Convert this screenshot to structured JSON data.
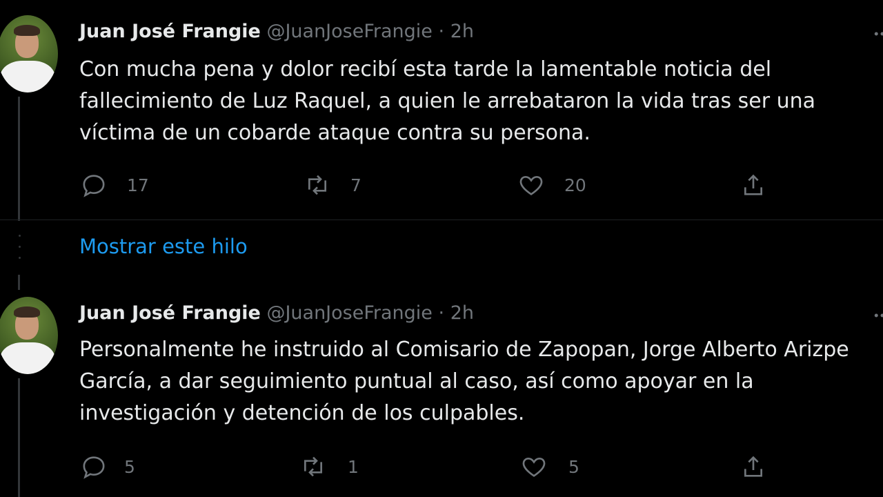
{
  "tweets": [
    {
      "name": "Juan José Frangie",
      "handle": "@JuanJoseFrangie",
      "separator": "·",
      "time": "2h",
      "text": "Con mucha pena y dolor recibí esta tarde la lamentable noticia del fallecimiento de Luz Raquel, a quien le arrebataron la vida tras ser una víctima de un cobarde ataque contra su persona.",
      "replies": "17",
      "retweets": "7",
      "likes": "20"
    },
    {
      "name": "Juan José Frangie",
      "handle": "@JuanJoseFrangie",
      "separator": "·",
      "time": "2h",
      "text": "Personalmente he instruido al Comisario de Zapopan, Jorge Alberto Arizpe García, a dar seguimiento puntual al caso, así como apoyar en la investigación y detención de los culpables.",
      "replies": "5",
      "retweets": "1",
      "likes": "5"
    }
  ],
  "show_thread": "Mostrar este hilo",
  "icons": {
    "reply": "reply-icon",
    "retweet": "retweet-icon",
    "like": "heart-icon",
    "share": "share-icon"
  },
  "colors": {
    "background": "#000000",
    "text": "#e7e9ea",
    "muted": "#71767b",
    "link": "#1d9bf0"
  }
}
